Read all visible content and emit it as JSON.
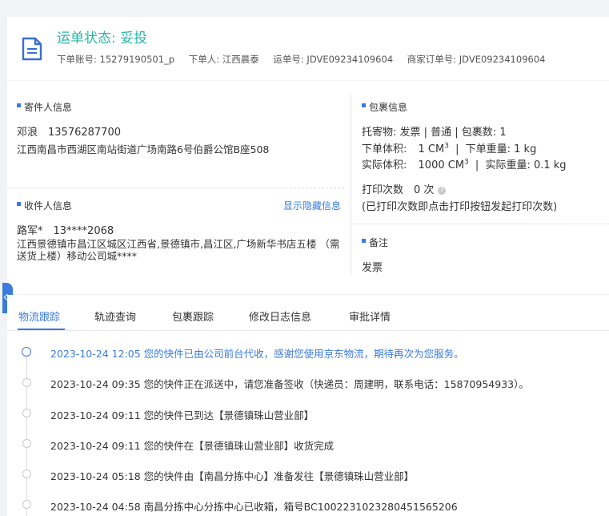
{
  "header": {
    "status_title": "运单状态: 妥投",
    "order_account": "下单账号: 15279190501_p",
    "orderer": "下单人: 江西晨泰",
    "waybill_no": "运单号: JDVE09234109604",
    "merchant_order_no": "商家订单号: JDVE09234109604"
  },
  "sender": {
    "title": "寄件人信息",
    "name_phone": "邓浪　13576287700",
    "address": "江西南昌市西湖区南站街道广场南路6号伯爵公馆B座508"
  },
  "receiver": {
    "title": "收件人信息",
    "toggle_label": "显示隐藏信息",
    "name_phone": "路军*　13****2068",
    "address": "江西景德镇市昌江区城区江西省,景德镇市,昌江区,广场新华书店五楼 （需送货上楼）移动公司城****"
  },
  "package": {
    "title": "包裹信息",
    "line1": "托寄物:  发票 | 普通  |  包裹数:  1",
    "vol_label": "下单体积:",
    "vol_value": "1 CM",
    "vol_weight": "下单重量:  1 kg",
    "actual_vol_label": "实际体积:",
    "actual_vol_value": "1000 CM",
    "actual_weight": "实际重量:  0.1 kg",
    "cube_exp": "3",
    "print_count": "打印次数　0 次",
    "print_hint": "(已打印次数即点击打印按钮发起打印次数)"
  },
  "remark": {
    "title": "备注",
    "content": "发票"
  },
  "tabs": [
    {
      "label": "物流跟踪"
    },
    {
      "label": "轨迹查询"
    },
    {
      "label": "包裹跟踪"
    },
    {
      "label": "修改日志信息"
    },
    {
      "label": "审批详情"
    }
  ],
  "timeline": [
    {
      "text": "2023-10-24 12:05 您的快件已由公司前台代收，感谢您使用京东物流，期待再次为您服务。"
    },
    {
      "text": "2023-10-24 09:35 您的快件正在派送中，请您准备签收（快递员：周建明，联系电话：15870954933）。"
    },
    {
      "text": "2023-10-24 09:11 您的快件已到达【景德镇珠山营业部】"
    },
    {
      "text": "2023-10-24 09:11 您的快件在【景德镇珠山营业部】收货完成"
    },
    {
      "text": "2023-10-24 05:18 您的快件由【南昌分拣中心】准备发往【景德镇珠山营业部】"
    },
    {
      "text": "2023-10-24 04:58 南昌分拣中心分拣中心已收箱，箱号BC1002231023280451565206"
    }
  ],
  "colors": {
    "accent": "#3a7bdc",
    "status": "#2bb7a7"
  }
}
